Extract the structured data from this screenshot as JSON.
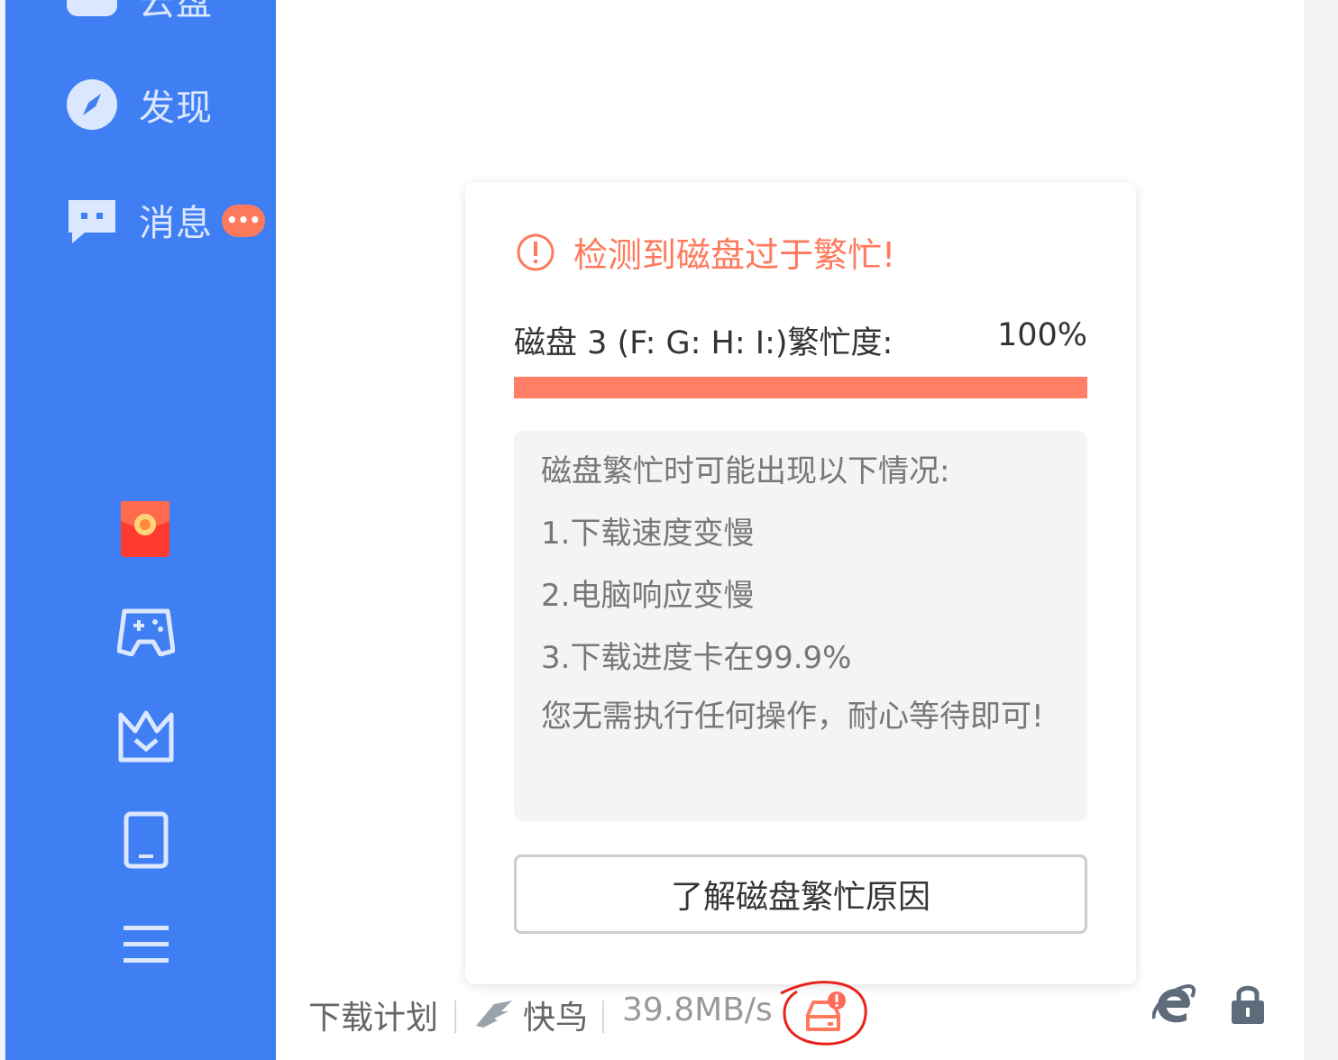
{
  "sidebar": {
    "top_item_label": "云盘",
    "discover_label": "发现",
    "message_label": "消息",
    "message_badge": "•••"
  },
  "popup": {
    "title": "检测到磁盘过于繁忙!",
    "disk_label": "磁盘 3 (F: G: H: I:)繁忙度:",
    "busy_percent_text": "100%",
    "busy_fraction": 1.0,
    "info_lines": [
      "磁盘繁忙时可能出现以下情况:",
      "1.下载速度变慢",
      "2.电脑响应变慢",
      "3.下载进度卡在99.9%",
      "您无需执行任何操作，耐心等待即可!"
    ],
    "button_label": "了解磁盘繁忙原因"
  },
  "statusbar": {
    "plan_label": "下载计划",
    "bird_label": "快鸟",
    "speed": "39.8MB/s"
  },
  "colors": {
    "sidebar_bg": "#3f7ff3",
    "warning": "#ff7a5c",
    "progress": "#ff7e66",
    "annotation": "#e8231c"
  },
  "icons": [
    "cloud-icon",
    "compass-icon",
    "chat-icon",
    "red-packet-icon",
    "gamepad-icon",
    "crown-icon",
    "phone-icon",
    "menu-icon",
    "warning-circle-icon",
    "bird-icon",
    "disk-alert-icon",
    "ie-icon",
    "lock-icon"
  ]
}
